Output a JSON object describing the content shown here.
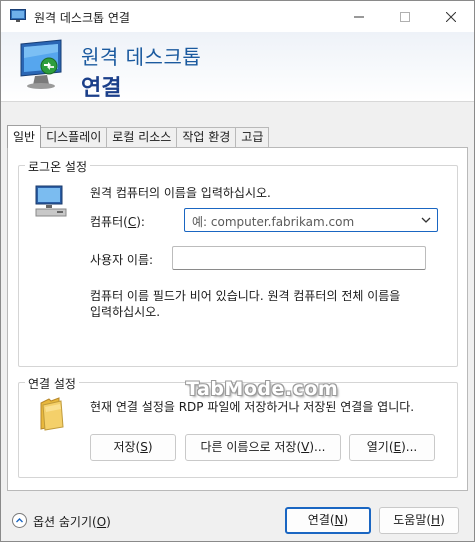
{
  "window": {
    "title": "원격 데스크톱 연결",
    "min_icon": "minimize-icon",
    "max_icon": "maximize-icon",
    "close_icon": "close-icon"
  },
  "banner": {
    "title_line1": "원격 데스크톱",
    "title_line2": "연결"
  },
  "tabs": [
    {
      "label": "일반",
      "active": true
    },
    {
      "label": "디스플레이",
      "active": false
    },
    {
      "label": "로컬 리소스",
      "active": false
    },
    {
      "label": "작업 환경",
      "active": false
    },
    {
      "label": "고급",
      "active": false
    }
  ],
  "logon": {
    "legend": "로그온 설정",
    "prompt": "원격 컴퓨터의 이름을 입력하십시오.",
    "computer_label": "컴퓨터(",
    "computer_accel": "C",
    "computer_label_end": "):",
    "computer_placeholder": "예: computer.fabrikam.com",
    "username_label": "사용자 이름:",
    "username_value": "",
    "hint_line1": "컴퓨터 이름 필드가 비어 있습니다. 원격 컴퓨터의 전체 이름을",
    "hint_line2": "입력하십시오."
  },
  "connection": {
    "legend": "연결 설정",
    "description": "현재 연결 설정을 RDP 파일에 저장하거나 저장된 연결을 엽니다.",
    "save_label": "저장(",
    "save_accel": "S",
    "saveas_label": "다른 이름으로 저장(",
    "saveas_accel": "V",
    "saveas_end": ")...",
    "open_label": "열기(",
    "open_accel": "E",
    "open_end": ")..."
  },
  "footer": {
    "options_label": "옵션 숨기기(",
    "options_accel": "O",
    "connect_label": "연결(",
    "connect_accel": "N",
    "help_label": "도움말(",
    "help_accel": "H"
  },
  "watermark": "TabMode.com",
  "colors": {
    "accent": "#1a66c2",
    "banner_title": "#1b5a9f"
  }
}
